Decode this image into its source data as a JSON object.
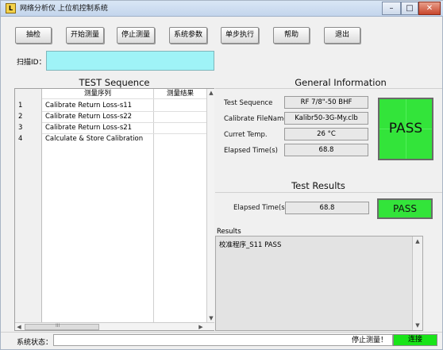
{
  "window": {
    "title": "网络分析仪 上位机控制系统",
    "controls": {
      "minimize": "–",
      "maximize": "□",
      "close": "✕"
    }
  },
  "toolbar": {
    "buttons": [
      "抽检",
      "开始测量",
      "停止测量",
      "系统参数",
      "单步执行",
      "帮助",
      "退出"
    ]
  },
  "scan": {
    "label": "扫描ID：",
    "value": ""
  },
  "test_sequence": {
    "title": "TEST Sequence",
    "columns": [
      "测量序列",
      "测量结果"
    ],
    "rows": [
      {
        "index": "1",
        "name": "Calibrate Return Loss-s11",
        "result": ""
      },
      {
        "index": "2",
        "name": "Calibrate Return Loss-s22",
        "result": ""
      },
      {
        "index": "3",
        "name": "Calibrate Return Loss-s21",
        "result": ""
      },
      {
        "index": "4",
        "name": "Calculate & Store Calibration",
        "result": ""
      }
    ],
    "hscroll_grip": "III"
  },
  "general_info": {
    "title": "General Information",
    "fields": [
      {
        "label": "Test Sequence",
        "value": "RF 7/8\"-50 BHF"
      },
      {
        "label": "Calibrate FileName",
        "value": "Kalibr50-3G-My.clb"
      },
      {
        "label": "Curret Temp.",
        "value": "26 °C"
      },
      {
        "label": "Elapsed Time(s)",
        "value": "68.8"
      }
    ],
    "pass": "PASS"
  },
  "test_results": {
    "title": "Test Results",
    "elapsed_label": "Elapsed Time(s)",
    "elapsed_value": "68.8",
    "pass": "PASS"
  },
  "results": {
    "label": "Results",
    "text": "校准程序_S11 PASS"
  },
  "statusbar": {
    "label": "系统状态：",
    "message": "停止测量！",
    "connect": "连接"
  },
  "colors": {
    "pass_green": "#33e43a",
    "connect_green": "#19e419",
    "scan_cyan": "#9ff3f7"
  }
}
